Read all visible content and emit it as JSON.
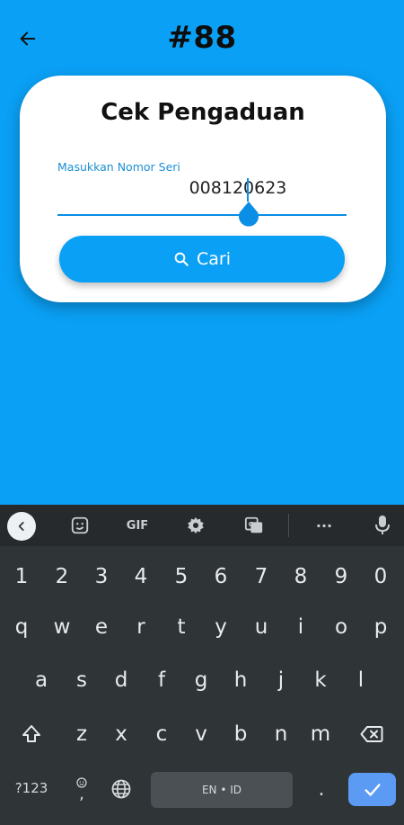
{
  "header": {
    "title": "#88",
    "back_icon": "arrow-left-icon"
  },
  "card": {
    "title": "Cek Pengaduan",
    "field_label": "Masukkan Nomor Seri",
    "field_value": "008120623",
    "button_label": "Cari",
    "button_icon": "search-icon"
  },
  "keyboard": {
    "toolbar": {
      "back_icon": "chevron-left-icon",
      "sticker_icon": "sticker-icon",
      "gif_label": "GIF",
      "settings_icon": "gear-icon",
      "translate_icon": "translate-icon",
      "more_label": "···",
      "mic_icon": "microphone-icon"
    },
    "number_row": [
      "1",
      "2",
      "3",
      "4",
      "5",
      "6",
      "7",
      "8",
      "9",
      "0"
    ],
    "row1": [
      "q",
      "w",
      "e",
      "r",
      "t",
      "y",
      "u",
      "i",
      "o",
      "p"
    ],
    "row2": [
      "a",
      "s",
      "d",
      "f",
      "g",
      "h",
      "j",
      "k",
      "l"
    ],
    "row3": [
      "z",
      "x",
      "c",
      "v",
      "b",
      "n",
      "m"
    ],
    "shift_icon": "shift-icon",
    "backspace_icon": "backspace-icon",
    "symbols_label": "?123",
    "comma_label": ",",
    "emoji_icon": "emoji-icon",
    "globe_icon": "globe-icon",
    "space_label": "EN • ID",
    "period_label": ".",
    "enter_icon": "check-icon"
  },
  "colors": {
    "primary": "#0aa0f5",
    "keyboard_bg": "#2f3436",
    "enter_key": "#5b9bf3"
  }
}
